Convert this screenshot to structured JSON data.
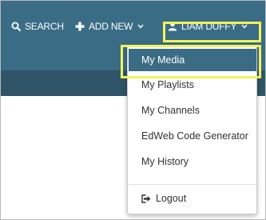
{
  "nav": {
    "search_label": "SEARCH",
    "add_new_label": "ADD NEW",
    "user_name": "LIAM DUFFY",
    "icons": {
      "search": "search-icon",
      "add": "plus-icon",
      "user": "user-icon",
      "caret": "chevron-down-icon"
    }
  },
  "menu": {
    "items": [
      {
        "label": "My Media",
        "active": true
      },
      {
        "label": "My Playlists",
        "active": false
      },
      {
        "label": "My Channels",
        "active": false
      },
      {
        "label": "EdWeb Code Generator",
        "active": false
      },
      {
        "label": "My History",
        "active": false
      }
    ],
    "logout_label": "Logout",
    "logout_icon": "sign-out-icon"
  },
  "colors": {
    "topbar": "#3a6c85",
    "subbar": "#2f5468",
    "highlight": "#f2f25a",
    "active_item": "#3a6c85"
  }
}
